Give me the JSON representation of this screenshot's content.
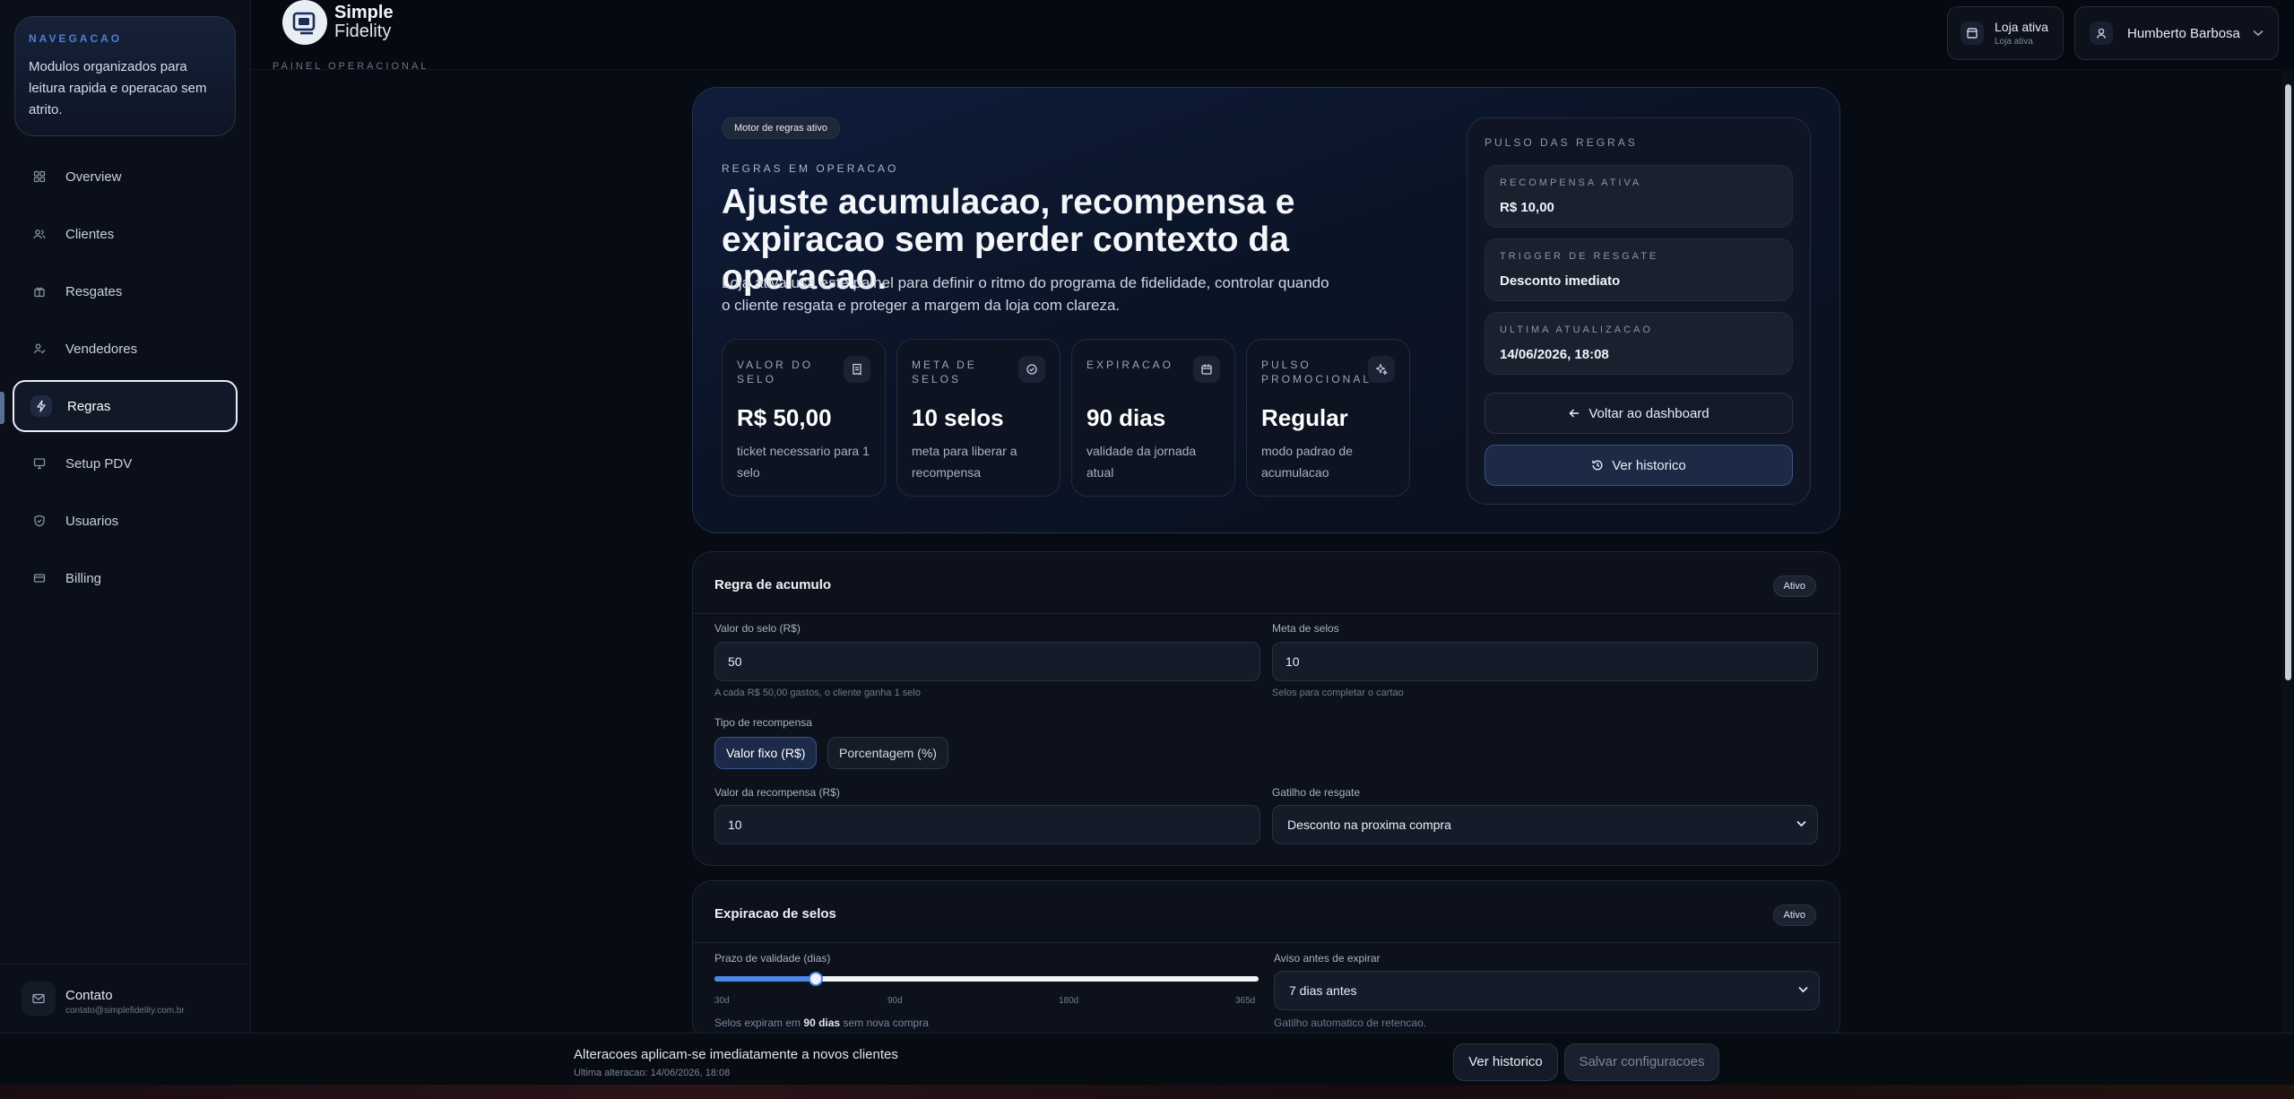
{
  "brand": {
    "name_line1": "Simple",
    "name_line2": "Fidelity",
    "caption": "PAINEL OPERACIONAL"
  },
  "header": {
    "store": {
      "title": "Loja ativa",
      "subtitle": "Loja ativa",
      "icon": "store-icon"
    },
    "user": {
      "name": "Humberto Barbosa",
      "icon": "user-icon"
    }
  },
  "sidebar": {
    "card_kicker": "NAVEGACAO",
    "card_text": "Modulos organizados para leitura rapida e operacao sem atrito.",
    "items": [
      {
        "label": "Overview",
        "icon": "grid-icon"
      },
      {
        "label": "Clientes",
        "icon": "users-icon"
      },
      {
        "label": "Resgates",
        "icon": "gift-icon"
      },
      {
        "label": "Vendedores",
        "icon": "user-check-icon"
      },
      {
        "label": "Regras",
        "icon": "zap-icon",
        "active": true
      },
      {
        "label": "Setup PDV",
        "icon": "monitor-icon"
      },
      {
        "label": "Usuarios",
        "icon": "shield-icon"
      },
      {
        "label": "Billing",
        "icon": "credit-card-icon"
      }
    ],
    "contact": {
      "title": "Contato",
      "email": "contato@simplefidelity.com.br"
    }
  },
  "hero": {
    "badge": "Motor de regras ativo",
    "eyebrow": "REGRAS EM OPERACAO",
    "headline": "Ajuste acumulacao, recompensa e expiracao sem perder contexto da operacao.",
    "description": "Loja ativa usa este painel para definir o ritmo do programa de fidelidade, controlar quando o cliente resgata e proteger a margem da loja com clareza.",
    "metrics": [
      {
        "key": "VALOR DO SELO",
        "value": "R$ 50,00",
        "desc": "ticket necessario para 1 selo",
        "icon": "receipt-icon"
      },
      {
        "key": "META DE SELOS",
        "value": "10 selos",
        "desc": "meta para liberar a recompensa",
        "icon": "target-icon"
      },
      {
        "key": "EXPIRACAO",
        "value": "90 dias",
        "desc": "validade da jornada atual",
        "icon": "calendar-icon"
      },
      {
        "key": "PULSO PROMOCIONAL",
        "value": "Regular",
        "desc": "modo padrao de acumulacao",
        "icon": "sparkles-icon"
      }
    ]
  },
  "pulse": {
    "title": "PULSO DAS REGRAS",
    "cards": [
      {
        "key": "RECOMPENSA ATIVA",
        "value": "R$ 10,00"
      },
      {
        "key": "TRIGGER DE RESGATE",
        "value": "Desconto imediato"
      },
      {
        "key": "ULTIMA ATUALIZACAO",
        "value": "14/06/2026, 18:08"
      }
    ],
    "back_label": "Voltar ao dashboard",
    "history_label": "Ver historico"
  },
  "accumulation": {
    "title": "Regra de acumulo",
    "status": "Ativo",
    "stamp_value_label": "Valor do selo (R$)",
    "stamp_value": "50",
    "stamp_value_help": "A cada R$ 50,00 gastos, o cliente ganha 1 selo",
    "goal_label": "Meta de selos",
    "goal_value": "10",
    "goal_help": "Selos para completar o cartao",
    "reward_type_label": "Tipo de recompensa",
    "reward_type_options": [
      "Valor fixo (R$)",
      "Porcentagem (%)"
    ],
    "reward_value_label": "Valor da recompensa (R$)",
    "reward_value": "10",
    "trigger_label": "Gatilho de resgate",
    "trigger_value": "Desconto na proxima compra"
  },
  "expiration": {
    "title": "Expiracao de selos",
    "status": "Ativo",
    "validity_label": "Prazo de validade (dias)",
    "validity_days": 90,
    "slider_min_days": 30,
    "slider_max_days": 365,
    "ticks": [
      "30d",
      "90d",
      "180d",
      "365d"
    ],
    "validity_help_prefix": "Selos expiram em",
    "validity_help_bold": "90 dias",
    "validity_help_suffix": "sem nova compra",
    "warn_label": "Aviso antes de expirar",
    "warn_value": "7 dias antes",
    "warn_help": "Gatilho automatico de retencao."
  },
  "footer": {
    "title": "Alteracoes aplicam-se imediatamente a novos clientes",
    "subtitle": "Ultima alteracao: 14/06/2026, 18:08",
    "history_label": "Ver historico",
    "save_label": "Salvar configuracoes"
  },
  "colors": {
    "accent": "#4f87e6",
    "background": "#070b14",
    "panel": "#0c111b"
  }
}
